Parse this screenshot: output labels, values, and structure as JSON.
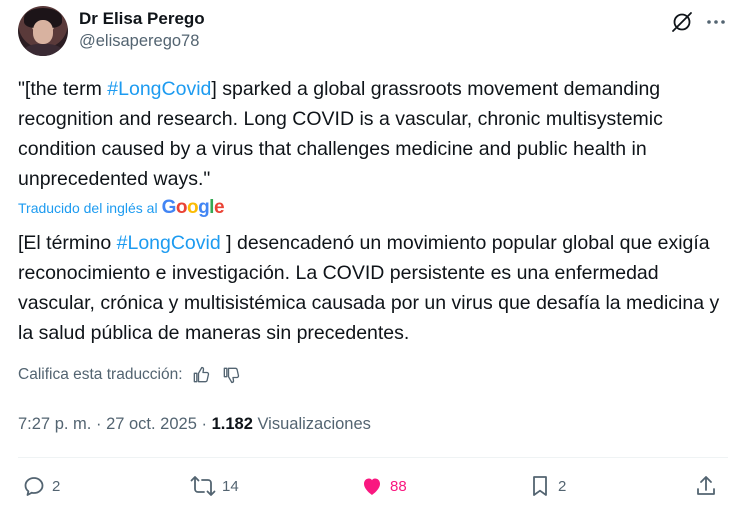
{
  "author": {
    "display_name": "Dr Elisa Perego",
    "handle": "@elisaperego78"
  },
  "tweet": {
    "text_before": "\"[the term ",
    "hashtag": "#LongCovid",
    "text_after": "] sparked a global grassroots movement demanding recognition and research. Long COVID is a vascular, chronic multisystemic condition caused by a virus that challenges medicine and public health in unprecedented ways.\""
  },
  "translation": {
    "label": "Traducido del inglés al",
    "provider": "Google",
    "text_before": "[El término ",
    "hashtag": "#LongCovid",
    "text_after": " ] desencadenó un movimiento popular global que exigía reconocimiento e investigación. La COVID persistente es una enfermedad vascular, crónica y multisistémica causada por un virus que desafía la medicina y la salud pública de maneras sin precedentes.",
    "rate_label": "Califica esta traducción:"
  },
  "meta": {
    "time": "7:27 p. m.",
    "separator": "·",
    "date": "27 oct. 2025",
    "views_count": "1.182",
    "views_label": "Visualizaciones"
  },
  "actions": {
    "replies": "2",
    "reposts": "14",
    "likes": "88",
    "bookmarks": "2"
  },
  "colors": {
    "link": "#1d9bf0",
    "secondary_text": "#536471",
    "like": "#f91880"
  }
}
